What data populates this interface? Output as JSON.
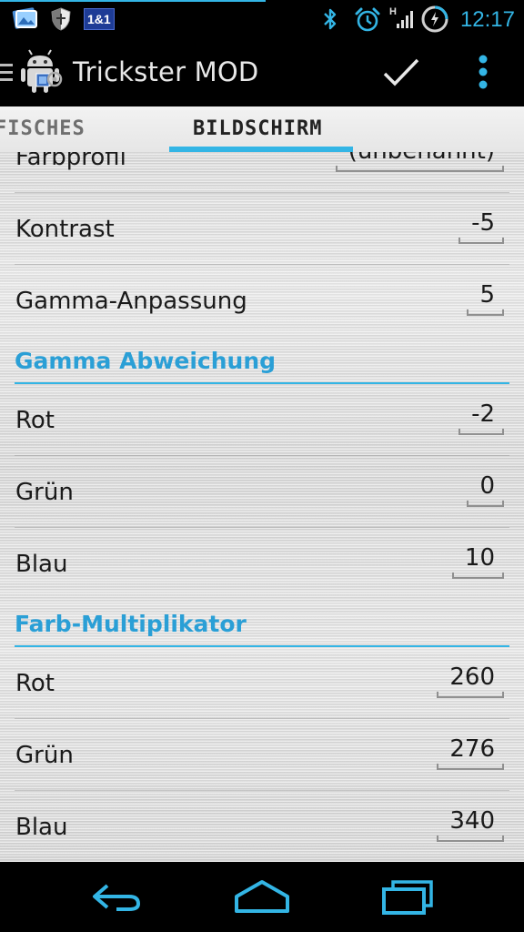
{
  "status_bar": {
    "clock": "12:17",
    "carrier_badge": "1&1",
    "network_type": "H",
    "icons": [
      "photos-icon",
      "shield-icon",
      "carrier-badge-icon",
      "bluetooth-icon",
      "alarm-icon",
      "signal-icon",
      "battery-charging-icon"
    ],
    "accent": "#33b5e5"
  },
  "action_bar": {
    "title": "Trickster MOD",
    "icons": [
      "drawer-menu-icon",
      "android-app-icon",
      "checkmark-icon",
      "overflow-menu-icon"
    ]
  },
  "tabs": {
    "previous": "FISCHES",
    "current": "BILDSCHIRM"
  },
  "settings": {
    "farbprofil": {
      "label": "Farbprofil",
      "value": "(unbenannt)"
    },
    "kontrast": {
      "label": "Kontrast",
      "value": "-5"
    },
    "gamma_anpassung": {
      "label": "Gamma-Anpassung",
      "value": "5"
    },
    "gamma_abweichung": {
      "title": "Gamma Abweichung",
      "rot": {
        "label": "Rot",
        "value": "-2"
      },
      "gruen": {
        "label": "Grün",
        "value": "0"
      },
      "blau": {
        "label": "Blau",
        "value": "10"
      }
    },
    "farb_multiplikator": {
      "title": "Farb-Multiplikator",
      "rot": {
        "label": "Rot",
        "value": "260"
      },
      "gruen": {
        "label": "Grün",
        "value": "276"
      },
      "blau": {
        "label": "Blau",
        "value": "340"
      }
    }
  },
  "nav_bar": {
    "icons": [
      "back-icon",
      "home-icon",
      "recent-apps-icon"
    ],
    "icon_color": "#33b5e5"
  }
}
